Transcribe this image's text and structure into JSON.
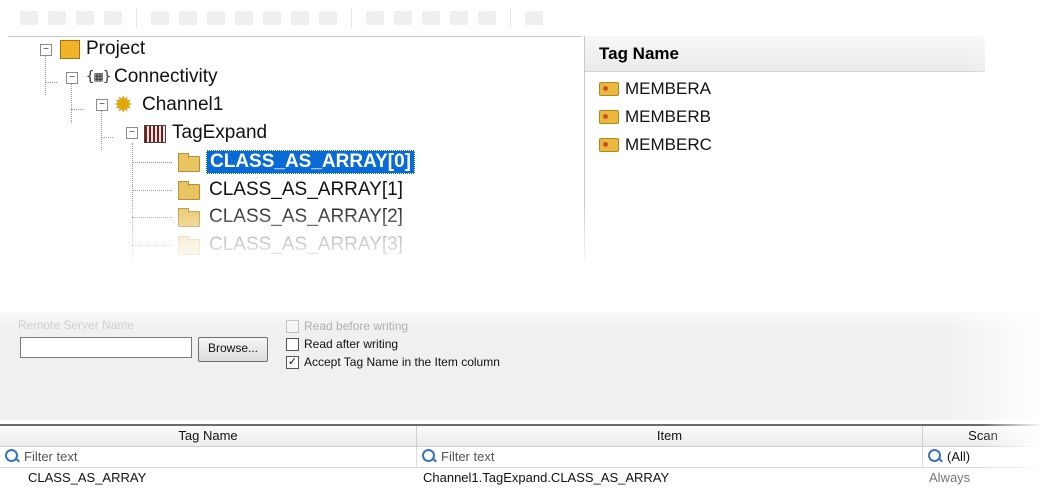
{
  "tree": {
    "root": "Project",
    "connectivity": "Connectivity",
    "channel": "Channel1",
    "device": "TagExpand",
    "items": [
      "CLASS_AS_ARRAY[0]",
      "CLASS_AS_ARRAY[1]",
      "CLASS_AS_ARRAY[2]",
      "CLASS_AS_ARRAY[3]"
    ],
    "selected_index": 0
  },
  "tag_list": {
    "header": "Tag Name",
    "tags": [
      "MEMBERA",
      "MEMBERB",
      "MEMBERC"
    ]
  },
  "settings": {
    "remote_server_label": "Remote Server Name",
    "browse_label": "Browse...",
    "read_before_label": "Read before writing",
    "read_after_label": "Read after writing",
    "accept_tag_label": "Accept Tag Name in the Item column",
    "accept_tag_checked": true
  },
  "grid": {
    "columns": [
      "Tag Name",
      "Item",
      "Scan"
    ],
    "filter_placeholder": "Filter text",
    "scan_filter": "(All)",
    "rows": [
      {
        "tag": "CLASS_AS_ARRAY",
        "item": "Channel1.TagExpand.CLASS_AS_ARRAY",
        "scan": "Always"
      }
    ]
  },
  "icons": [
    "project-icon",
    "connectivity-icon",
    "channel-gear-icon",
    "device-icon",
    "folder-icon",
    "tag-icon",
    "search-icon",
    "checkbox-checked-icon"
  ]
}
